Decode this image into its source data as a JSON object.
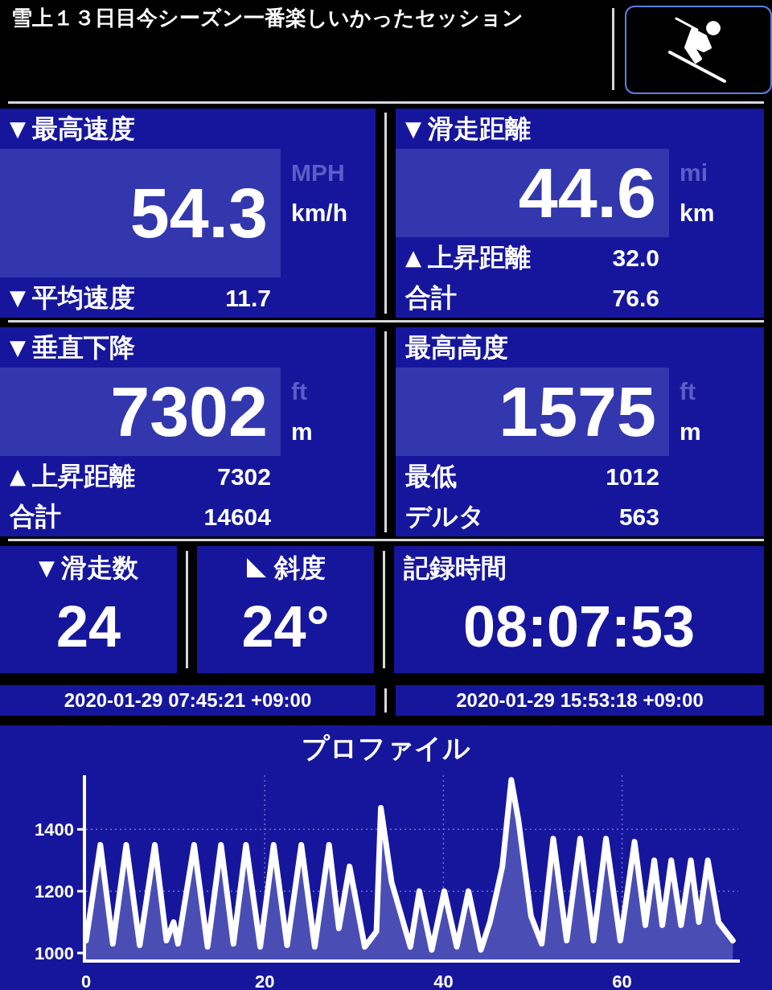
{
  "header": {
    "title": "雪上１３日目今シーズン一番楽しいかったセッション"
  },
  "panels": [
    {
      "arrow": "▼",
      "title": "最高速度",
      "value": "54.3",
      "units": [
        {
          "label": "MPH",
          "selected": false
        },
        {
          "label": "km/h",
          "selected": true
        }
      ],
      "rows": [
        {
          "arrow": "▼",
          "label": "平均速度",
          "value": "11.7"
        }
      ]
    },
    {
      "arrow": "▼",
      "title": "滑走距離",
      "value": "44.6",
      "units": [
        {
          "label": "mi",
          "selected": false
        },
        {
          "label": "km",
          "selected": true
        }
      ],
      "rows": [
        {
          "arrow": "▲",
          "label": "上昇距離",
          "value": "32.0"
        },
        {
          "label": "合計",
          "value": "76.6"
        }
      ]
    },
    {
      "arrow": "▼",
      "title": "垂直下降",
      "value": "7302",
      "units": [
        {
          "label": "ft",
          "selected": false
        },
        {
          "label": "m",
          "selected": true
        }
      ],
      "rows": [
        {
          "arrow": "▲",
          "label": "上昇距離",
          "value": "7302"
        },
        {
          "label": "合計",
          "value": "14604"
        }
      ]
    },
    {
      "title": "最高高度",
      "value": "1575",
      "units": [
        {
          "label": "ft",
          "selected": false
        },
        {
          "label": "m",
          "selected": true
        }
      ],
      "rows": [
        {
          "label": "最低",
          "value": "1012"
        },
        {
          "label": "デルタ",
          "value": "563"
        }
      ]
    }
  ],
  "tiles": [
    {
      "kind": "arrow",
      "arrow": "▼",
      "title": "滑走数",
      "value": "24"
    },
    {
      "kind": "slope",
      "title": "斜度",
      "value": "24°"
    },
    {
      "kind": "plain",
      "title": "記録時間",
      "value": "08:07:53"
    }
  ],
  "times": [
    "2020-01-29 07:45:21 +09:00",
    "2020-01-29 15:53:18 +09:00"
  ],
  "profile": {
    "title": "プロファイル",
    "chart_data": {
      "type": "area",
      "x": [
        0,
        1.6,
        3,
        4.5,
        6,
        7.7,
        9,
        9.8,
        10.3,
        12.1,
        13.6,
        15.1,
        16.5,
        17.9,
        19.5,
        21,
        22.5,
        24.1,
        25.6,
        27.2,
        28.3,
        29.5,
        31.2,
        32.5,
        33,
        34.2,
        36.3,
        37.3,
        38.7,
        40.1,
        41.5,
        42.8,
        44.2,
        45.2,
        46,
        46.6,
        47.6,
        48.4,
        49.8,
        51,
        52.3,
        53.8,
        55.3,
        56.8,
        58.2,
        59.8,
        61.4,
        62.6,
        63.6,
        64.5,
        65.5,
        66.6,
        67.7,
        68.6,
        69.6,
        70.8,
        72.4
      ],
      "grid": true,
      "series": [
        {
          "color": "#ffffff",
          "values": [
            1040,
            1350,
            1030,
            1350,
            1025,
            1350,
            1040,
            1100,
            1030,
            1350,
            1020,
            1350,
            1030,
            1350,
            1020,
            1350,
            1025,
            1350,
            1020,
            1350,
            1080,
            1280,
            1020,
            1070,
            1470,
            1230,
            1020,
            1200,
            1010,
            1200,
            1020,
            1200,
            1010,
            1100,
            1200,
            1280,
            1560,
            1430,
            1120,
            1030,
            1370,
            1040,
            1370,
            1040,
            1370,
            1040,
            1360,
            1090,
            1300,
            1090,
            1300,
            1090,
            1300,
            1100,
            1300,
            1100,
            1040
          ]
        }
      ],
      "xlim": [
        0,
        73
      ],
      "ylim": [
        974,
        1575
      ],
      "xticks": [
        0,
        20,
        40,
        60
      ],
      "yticks": [
        1000,
        1200,
        1400
      ]
    }
  }
}
